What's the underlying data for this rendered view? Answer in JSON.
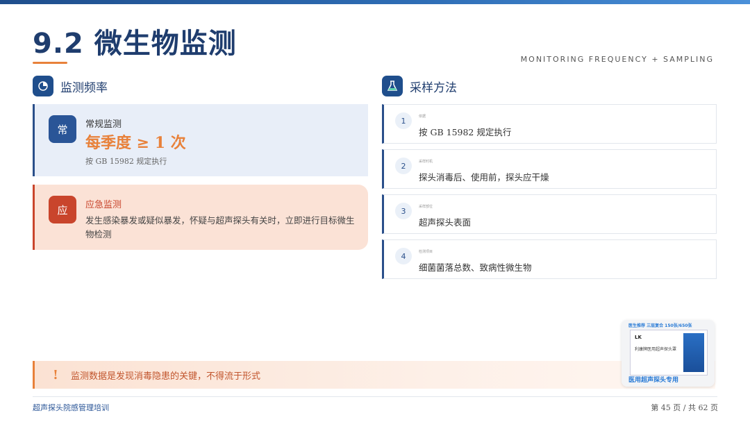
{
  "slide": {
    "title": "9.2 微生物监测",
    "subtitle_en": "MONITORING FREQUENCY + SAMPLING"
  },
  "left_section": {
    "heading": "监测频率",
    "icon": "pie-chart-icon",
    "routine": {
      "badge": "常",
      "title": "常规监测",
      "frequency": "每季度 ≥ 1 次",
      "note": "按 GB 15982 规定执行"
    },
    "emergency": {
      "badge": "应",
      "title": "应急监测",
      "description": "发生感染暴发或疑似暴发，怀疑与超声探头有关时，立即进行目标微生物检测"
    }
  },
  "right_section": {
    "heading": "采样方法",
    "icon": "flask-icon",
    "steps": [
      {
        "num": "1",
        "tag": "依据",
        "text": "按 GB 15982 规定执行"
      },
      {
        "num": "2",
        "tag": "采样时机",
        "text": "探头消毒后、使用前，探头应干燥"
      },
      {
        "num": "3",
        "tag": "采样部位",
        "text": "超声探头表面"
      },
      {
        "num": "4",
        "tag": "检测项目",
        "text": "细菌菌落总数、致病性微生物"
      }
    ]
  },
  "alert": {
    "mark": "!",
    "text": "监测数据是发现消毒隐患的关键，不得流于形式"
  },
  "product_photo": {
    "top_text": "医生推荐 三层复合 150张/650张",
    "brand": "LK",
    "product_name": "利康牌医用超声探头罩",
    "bottom_text": "医用超声探头专用"
  },
  "footer": {
    "left": "超声探头院感管理培训",
    "right": "第 45 页 / 共 62 页"
  },
  "colors": {
    "primary": "#1f4e8c",
    "accent": "#e8813a",
    "danger": "#c9452c"
  }
}
